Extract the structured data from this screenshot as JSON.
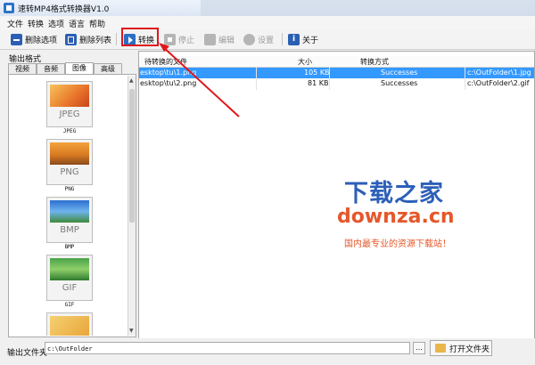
{
  "window": {
    "title": "速转MP4格式转换器V1.0"
  },
  "menu": [
    "文件",
    "转换",
    "选项",
    "语言",
    "帮助"
  ],
  "toolbar": {
    "delete_option": "删除选项",
    "delete_list": "删除列表",
    "convert": "转换",
    "stop": "停止",
    "edit": "编辑",
    "settings": "设置",
    "about": "关于"
  },
  "left_panel": {
    "title": "输出格式",
    "tabs": [
      "视频",
      "音频",
      "图像",
      "高级"
    ],
    "active_tab": "图像",
    "formats": [
      {
        "ext": "JPEG",
        "name": "JPEG"
      },
      {
        "ext": "PNG",
        "name": "PNG"
      },
      {
        "ext": "BMP",
        "name": "BMP"
      },
      {
        "ext": "GIF",
        "name": "GIF"
      }
    ]
  },
  "file_list": {
    "columns": [
      "待转换的文件",
      "大小",
      "转换方式"
    ],
    "rows": [
      {
        "file": "esktop\\tu\\1.png",
        "size": "105 KB",
        "status": "Successes",
        "output": "c:\\OutFolder\\1.jpg",
        "selected": true
      },
      {
        "file": "esktop\\tu\\2.png",
        "size": "81 KB",
        "status": "Successes",
        "output": "c:\\OutFolder\\2.gif",
        "selected": false
      }
    ]
  },
  "watermark": {
    "title": "下载之家",
    "url": "downza.cn",
    "slogan": "国内最专业的资源下载站！",
    "title_color": "#2d5fb8",
    "accent_color": "#e5572a"
  },
  "bottom": {
    "output_label": "输出文件夹",
    "output_path": "c:\\OutFolder",
    "browse": "...",
    "open_folder": "打开文件夹"
  },
  "colors": {
    "selection": "#3399ff",
    "highlight_box": "#e0161c"
  }
}
